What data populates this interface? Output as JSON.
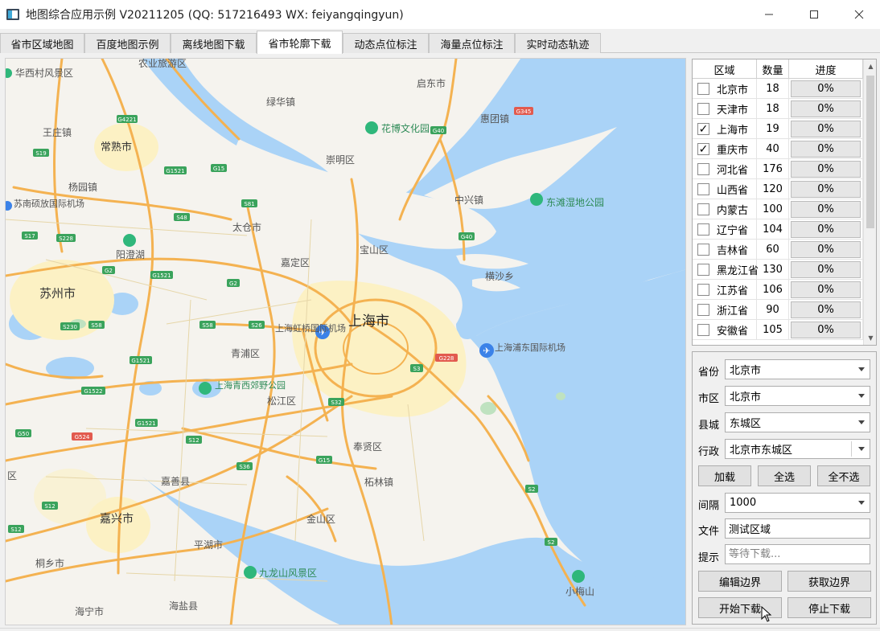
{
  "window": {
    "title": "地图综合应用示例 V20211205 (QQ: 517216493 WX: feiyangqingyun)",
    "minimize_icon": "minimize-icon",
    "maximize_icon": "maximize-icon",
    "close_icon": "close-icon"
  },
  "tabs": [
    {
      "label": "省市区域地图"
    },
    {
      "label": "百度地图示例"
    },
    {
      "label": "离线地图下载"
    },
    {
      "label": "省市轮廓下载",
      "active": true
    },
    {
      "label": "动态点位标注"
    },
    {
      "label": "海量点位标注"
    },
    {
      "label": "实时动态轨迹"
    }
  ],
  "map": {
    "places": {
      "huaxi": "华西村风景区",
      "nongye": "农业旅游区",
      "qidong": "启东市",
      "lvsi": "绿华镇",
      "huitong": "惠团镇",
      "huajing": "花博文化园",
      "wangting": "王庄镇",
      "changshu": "常熟市",
      "chongming": "崇明区",
      "yangyuan": "杨园镇",
      "sunan": "苏南硕放国际机场",
      "dongtan": "东滩湿地公园",
      "zhongxing": "中兴镇",
      "taicang": "太仓市",
      "yangchenghu": "阳澄湖",
      "baoshan": "宝山区",
      "jiading": "嘉定区",
      "hengsha": "横沙乡",
      "suzhou": "苏州市",
      "shanghai": "上海市",
      "hongqiao": "上海虹桥国际机场",
      "pudong": "上海浦东国际机场",
      "qingpu": "青浦区",
      "qingxi": "上海青西郊野公园",
      "songjiang": "松江区",
      "fengxian": "奉贤区",
      "jiashan": "嘉善县",
      "zhelin": "柘林镇",
      "jiaxing": "嘉兴市",
      "jinshan": "金山区",
      "pinghu": "平湖市",
      "tongxiang": "桐乡市",
      "jiulongshan": "九龙山风景区",
      "xiaomeishan": "小梅山",
      "haining": "海宁市",
      "haiyan": "海盐县",
      "qu": "区"
    },
    "shields": [
      "G4221",
      "G40",
      "G345",
      "S19",
      "G1521",
      "G15",
      "S81",
      "S48",
      "S17",
      "S228",
      "G2",
      "G1521",
      "G2",
      "G40",
      "S230",
      "S58",
      "S58",
      "S26",
      "G1521",
      "G228",
      "S3",
      "G1522",
      "G1521",
      "G50",
      "G524",
      "S12",
      "S32",
      "S36",
      "G15",
      "S12",
      "S12",
      "S2",
      "S2"
    ]
  },
  "grid": {
    "headers": {
      "region": "区域",
      "count": "数量",
      "progress": "进度"
    },
    "rows": [
      {
        "name": "北京市",
        "count": "18",
        "progress": "0%",
        "checked": false
      },
      {
        "name": "天津市",
        "count": "18",
        "progress": "0%",
        "checked": false
      },
      {
        "name": "上海市",
        "count": "19",
        "progress": "0%",
        "checked": true
      },
      {
        "name": "重庆市",
        "count": "40",
        "progress": "0%",
        "checked": true
      },
      {
        "name": "河北省",
        "count": "176",
        "progress": "0%",
        "checked": false
      },
      {
        "name": "山西省",
        "count": "120",
        "progress": "0%",
        "checked": false
      },
      {
        "name": "内蒙古",
        "count": "100",
        "progress": "0%",
        "checked": false
      },
      {
        "name": "辽宁省",
        "count": "104",
        "progress": "0%",
        "checked": false
      },
      {
        "name": "吉林省",
        "count": "60",
        "progress": "0%",
        "checked": false
      },
      {
        "name": "黑龙江省",
        "count": "130",
        "progress": "0%",
        "checked": false
      },
      {
        "name": "江苏省",
        "count": "106",
        "progress": "0%",
        "checked": false
      },
      {
        "name": "浙江省",
        "count": "90",
        "progress": "0%",
        "checked": false
      },
      {
        "name": "安徽省",
        "count": "105",
        "progress": "0%",
        "checked": false
      }
    ],
    "check_mark": "✓"
  },
  "controls": {
    "province_label": "省份",
    "province_value": "北京市",
    "city_label": "市区",
    "city_value": "北京市",
    "county_label": "县城",
    "county_value": "东城区",
    "admin_label": "行政",
    "admin_value": "北京市东城区",
    "load_button": "加载",
    "select_all_button": "全选",
    "select_none_button": "全不选",
    "interval_label": "间隔",
    "interval_value": "1000",
    "file_label": "文件",
    "file_value": "测试区域",
    "hint_label": "提示",
    "hint_placeholder": "等待下载...",
    "edit_boundary_button": "编辑边界",
    "get_boundary_button": "获取边界",
    "start_download_button": "开始下载",
    "stop_download_button": "停止下载"
  },
  "colors": {
    "water": "#aad3f7",
    "land": "#f5f3ee",
    "urban": "#fcf1c4",
    "highway": "#f4b251",
    "park": "#2fb77b",
    "shield_green": "#3aa35c",
    "shield_red": "#e25a4e"
  }
}
